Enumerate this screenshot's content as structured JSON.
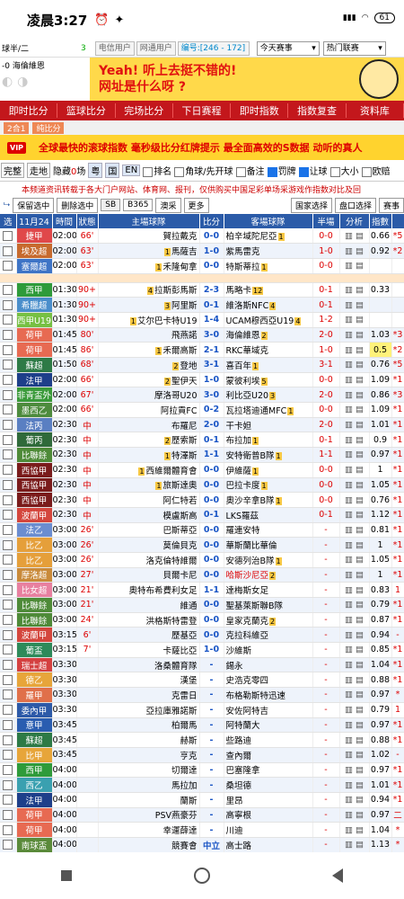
{
  "status": {
    "time": "凌晨3:27",
    "battery": "61"
  },
  "top": {
    "league_tag": "球半/二",
    "league_num": "3",
    "team_line": "-0",
    "team": "海倫維恩",
    "user1": "电信用户",
    "user2": "网通用户",
    "code": "编号:[246 - 172]",
    "select1": "今天赛事",
    "select2": "热门联赛"
  },
  "ad": {
    "line1": "Yeah! 听上去挺不错的!",
    "line2": "网址是什么呀 ?"
  },
  "nav": [
    "即时比分",
    "篮球比分",
    "完场比分",
    "下日赛程",
    "即时指数",
    "指数复查",
    "资料库"
  ],
  "subnav": [
    "2合1",
    "纯比分"
  ],
  "banner": "全球最快的滚球指数 毫秒级比分红牌提示 最全面高效的S数据 动听的真人",
  "filters": {
    "complete": "完整",
    "walk": "走地",
    "hidden": "隐藏",
    "hidden_count": "0",
    "hidden_unit": "场",
    "lang1": "粤",
    "lang2": "国",
    "lang3": "EN",
    "c1": "排名",
    "c2": "角球/先开球",
    "c3": "备注",
    "c4": "罚牌",
    "c5": "让球",
    "c6": "大小",
    "c7": "欧赔"
  },
  "notice": "本频道资讯转载于各大门户网站、体育网、报刊，仅供购买中国足彩单场采游戏作指数对比及回",
  "toolbar": {
    "keep": "保留选中",
    "delete": "删除选中",
    "sb": "SB",
    "b365": "B365",
    "macau": "澳采",
    "more": "更多",
    "country": "国家选择",
    "handicap": "盘口选择",
    "events": "赛事"
  },
  "headers": [
    "选",
    "11月24",
    "時間",
    "狀態",
    "主場球隊",
    "比分",
    "客場球隊",
    "半場",
    "分析",
    "指數"
  ],
  "rows": [
    {
      "league": "捷甲",
      "color": "#e0484a",
      "time": "02:00",
      "status": "66'",
      "home": "賀拉戴克",
      "score": "0-0",
      "away": "柏辛域陀尼亞",
      "ar": "1",
      "half": "0-0",
      "odds": "0.66",
      "ah": "*5"
    },
    {
      "league": "埃及超",
      "color": "#c76a2e",
      "time": "02:00",
      "status": "63'",
      "home": "馬薩吉",
      "hr": "1",
      "score": "1-0",
      "away": "紫馬雷克",
      "half": "1-0",
      "odds": "0.92",
      "ah": "*2"
    },
    {
      "league": "塞爾超",
      "color": "#3e74c6",
      "time": "02:00",
      "status": "63'",
      "home": "禾隆甸拿",
      "hr": "1",
      "score": "0-0",
      "away": "特斯蒂拉",
      "ar": "1",
      "half": "0-0",
      "odds": "",
      "ah": ""
    },
    {
      "sep": true
    },
    {
      "league": "西甲",
      "color": "#2f9b3a",
      "time": "01:30",
      "status": "90+",
      "home": "拉斯彭馬斯",
      "hr": "4",
      "score": "2-3",
      "away": "馬略卡",
      "ar": "12",
      "half": "0-1",
      "odds": "0.33",
      "ah": ""
    },
    {
      "league": "希臘超",
      "color": "#4a8ecb",
      "time": "01:30",
      "status": "90+",
      "home": "阿里斯",
      "hr": "3",
      "score": "0-1",
      "away": "維洛斯NFC",
      "ar": "4",
      "half": "0-1",
      "odds": "",
      "ah": ""
    },
    {
      "league": "西甲U19",
      "color": "#76c043",
      "time": "01:30",
      "status": "90+",
      "home": "艾尔巴卡特U19",
      "hr": "1",
      "score": "1-4",
      "away": "UCAM穆西亞U19",
      "ar": "4",
      "half": "1-2",
      "odds": "",
      "ah": ""
    },
    {
      "league": "荷甲",
      "color": "#e76a52",
      "time": "01:45",
      "status": "80'",
      "home": "飛燕諾",
      "score": "3-0",
      "away": "海倫維恩",
      "ar": "2",
      "half": "2-0",
      "odds": "1.03",
      "ah": "*3"
    },
    {
      "league": "荷甲",
      "color": "#e76a52",
      "time": "01:45",
      "status": "86'",
      "home": "禾爾高斯",
      "hr": "1",
      "score": "2-1",
      "away": "RKC華域克",
      "half": "1-0",
      "odds": "0.5",
      "ah": "*2",
      "hl": true
    },
    {
      "league": "蘇超",
      "color": "#2d7a46",
      "time": "01:50",
      "status": "68'",
      "home": "登地",
      "hr": "2",
      "score": "3-1",
      "away": "喜百年",
      "ar": "1",
      "half": "3-1",
      "odds": "0.76",
      "ah": "*5"
    },
    {
      "league": "法甲",
      "color": "#1e3f8a",
      "time": "02:00",
      "status": "66'",
      "home": "聖伊天",
      "hr": "2",
      "score": "1-0",
      "away": "蒙彼利埃",
      "ar": "5",
      "half": "0-0",
      "odds": "1.09",
      "ah": "*1"
    },
    {
      "league": "非青盃外",
      "color": "#3a9a3a",
      "time": "02:00",
      "status": "67'",
      "home": "摩洛哥U20",
      "score": "3-0",
      "away": "利比亞U20",
      "ar": "3",
      "half": "2-0",
      "odds": "0.86",
      "ah": "*3"
    },
    {
      "league": "墨西乙",
      "color": "#4d8b3d",
      "time": "02:00",
      "status": "66'",
      "home": "阿拉貢FC",
      "score": "0-2",
      "away": "瓦拉塔迪通MFC",
      "ar": "1",
      "half": "0-0",
      "odds": "1.09",
      "ah": "*1"
    },
    {
      "league": "法丙",
      "color": "#5a7fc2",
      "time": "02:30",
      "status": "中",
      "home": "布羅尼",
      "score": "2-0",
      "away": "干卡妲",
      "half": "2-0",
      "odds": "1.01",
      "ah": "*1"
    },
    {
      "league": "葡丙",
      "color": "#2f6a3a",
      "time": "02:30",
      "status": "中",
      "home": "歷索斯",
      "hr": "2",
      "score": "0-1",
      "away": "布拉加",
      "ar": "1",
      "half": "0-1",
      "odds": "0.9",
      "ah": "*1"
    },
    {
      "league": "比聯餘",
      "color": "#4e8a38",
      "time": "02:30",
      "status": "中",
      "home": "特澤斯",
      "hr": "1",
      "score": "1-1",
      "away": "安特衛普B隊",
      "ar": "1",
      "half": "1-1",
      "odds": "0.97",
      "ah": "*1"
    },
    {
      "league": "西協甲",
      "color": "#7a1b1b",
      "time": "02:30",
      "status": "中",
      "home": "西維爾體育會",
      "hr": "1",
      "score": "0-0",
      "away": "伊維薩",
      "ar": "1",
      "half": "0-0",
      "odds": "1",
      "ah": "*1"
    },
    {
      "league": "西協甲",
      "color": "#7a1b1b",
      "time": "02:30",
      "status": "中",
      "home": "旅斯達奧",
      "hr": "1",
      "score": "0-0",
      "away": "巴拉卡度",
      "ar": "1",
      "half": "0-0",
      "odds": "1.05",
      "ah": "*1"
    },
    {
      "league": "西協甲",
      "color": "#7a1b1b",
      "time": "02:30",
      "status": "中",
      "home": "阿仁特若",
      "score": "0-0",
      "away": "奧沙辛拿B隊",
      "ar": "1",
      "half": "0-0",
      "odds": "0.76",
      "ah": "*1"
    },
    {
      "league": "波蘭甲",
      "color": "#d4463d",
      "time": "02:30",
      "status": "中",
      "home": "模盧斯高",
      "score": "0-1",
      "away": "LKS羅茲",
      "half": "0-1",
      "odds": "1.12",
      "ah": "*1"
    },
    {
      "league": "法乙",
      "color": "#6b8dd0",
      "time": "03:00",
      "status": "26'",
      "home": "巴斯蒂亞",
      "score": "0-0",
      "away": "羅連安特",
      "half": "-",
      "odds": "0.81",
      "ah": "*1"
    },
    {
      "league": "比乙",
      "color": "#e59f3a",
      "time": "03:00",
      "status": "26'",
      "home": "莫倫貝克",
      "score": "0-0",
      "away": "華斯蘭比華倫",
      "half": "-",
      "odds": "1",
      "ah": "*1"
    },
    {
      "league": "比乙",
      "color": "#e59f3a",
      "time": "03:00",
      "status": "26'",
      "home": "洛克倫特維爾",
      "score": "0-0",
      "away": "安德列治B隊",
      "ar": "1",
      "half": "-",
      "odds": "1.05",
      "ah": "*1"
    },
    {
      "league": "摩洛超",
      "color": "#c98a3a",
      "time": "03:00",
      "status": "27'",
      "home": "貝爾卡尼",
      "score": "0-0",
      "away": "哈斯沙尼亞",
      "ar": "2",
      "half": "-",
      "odds": "1",
      "ah": "*1",
      "redaway": true
    },
    {
      "league": "比女超",
      "color": "#e880a0",
      "time": "03:00",
      "status": "21'",
      "home": "奧特布希費利女足",
      "score": "1-1",
      "away": "達梅斯女足",
      "half": "-",
      "odds": "0.83",
      "ah": "1"
    },
    {
      "league": "比聯餘",
      "color": "#4e8a38",
      "time": "03:00",
      "status": "21'",
      "home": "維通",
      "score": "0-0",
      "away": "聖基萊斯聯B隊",
      "half": "-",
      "odds": "0.79",
      "ah": "*1"
    },
    {
      "league": "比聯餘",
      "color": "#4e8a38",
      "time": "03:00",
      "status": "24'",
      "home": "洪格斯特雷登",
      "score": "0-0",
      "away": "皇家克蘭克",
      "ar": "2",
      "half": "-",
      "odds": "0.87",
      "ah": "*1"
    },
    {
      "league": "波蘭甲",
      "color": "#d4463d",
      "time": "03:15",
      "status": "6'",
      "home": "歷基亞",
      "score": "0-0",
      "away": "克拉科維亞",
      "half": "-",
      "odds": "0.94",
      "ah": "-"
    },
    {
      "league": "葡盃",
      "color": "#2d8a5a",
      "time": "03:15",
      "status": "7'",
      "home": "卡薩比亞",
      "score": "1-0",
      "away": "沙維斯",
      "half": "-",
      "odds": "0.85",
      "ah": "*1"
    },
    {
      "league": "瑞士超",
      "color": "#d44040",
      "time": "03:30",
      "status": "",
      "home": "洛桑體育隊",
      "score": "-",
      "away": "錫永",
      "half": "-",
      "odds": "1.04",
      "ah": "*1"
    },
    {
      "league": "德乙",
      "color": "#e7a53a",
      "time": "03:30",
      "status": "",
      "home": "漢堡",
      "score": "-",
      "away": "史浩克零四",
      "half": "-",
      "odds": "0.88",
      "ah": "*1"
    },
    {
      "league": "羅甲",
      "color": "#e0704a",
      "time": "03:30",
      "status": "",
      "home": "克雷日",
      "score": "-",
      "away": "布格勒斯特迅速",
      "half": "-",
      "odds": "0.97",
      "ah": "*"
    },
    {
      "league": "委內甲",
      "color": "#2d5aa8",
      "time": "03:30",
      "status": "",
      "home": "亞拉庫雅諾斯",
      "score": "-",
      "away": "安佐阿特吉",
      "half": "-",
      "odds": "0.79",
      "ah": "1"
    },
    {
      "league": "意甲",
      "color": "#2a5db0",
      "time": "03:45",
      "status": "",
      "home": "柏爾馬",
      "score": "-",
      "away": "阿特蘭大",
      "half": "-",
      "odds": "0.97",
      "ah": "*1"
    },
    {
      "league": "蘇超",
      "color": "#2d7a46",
      "time": "03:45",
      "status": "",
      "home": "赫斯",
      "score": "-",
      "away": "些路迪",
      "half": "-",
      "odds": "0.88",
      "ah": "*1"
    },
    {
      "league": "比甲",
      "color": "#e7a53a",
      "time": "03:45",
      "status": "",
      "home": "亨克",
      "score": "-",
      "away": "查內爾",
      "half": "-",
      "odds": "1.02",
      "ah": "-"
    },
    {
      "league": "西甲",
      "color": "#2f9b3a",
      "time": "04:00",
      "status": "",
      "home": "切爾達",
      "score": "-",
      "away": "巴塞隆拿",
      "half": "-",
      "odds": "0.97",
      "ah": "*1"
    },
    {
      "league": "西乙",
      "color": "#3aa0b0",
      "time": "04:00",
      "status": "",
      "home": "馬拉加",
      "score": "-",
      "away": "桑坦德",
      "half": "-",
      "odds": "1.01",
      "ah": "*1"
    },
    {
      "league": "法甲",
      "color": "#1e3f8a",
      "time": "04:00",
      "status": "",
      "home": "蘭斯",
      "score": "-",
      "away": "里昂",
      "half": "-",
      "odds": "0.94",
      "ah": "*1"
    },
    {
      "league": "荷甲",
      "color": "#e76a52",
      "time": "04:00",
      "status": "",
      "home": "PSV燕豪芬",
      "score": "-",
      "away": "高寧根",
      "half": "-",
      "odds": "0.97",
      "ah": "二"
    },
    {
      "league": "荷甲",
      "color": "#e76a52",
      "time": "04:00",
      "status": "",
      "home": "幸運薛達",
      "score": "-",
      "away": "川迪",
      "half": "-",
      "odds": "1.04",
      "ah": "*"
    },
    {
      "league": "南球盃",
      "color": "#5a8a3a",
      "time": "04:00",
      "status": "",
      "home": "競賽會",
      "score": "中立",
      "away": "高士路",
      "half": "-",
      "odds": "1.13",
      "ah": "*"
    }
  ]
}
